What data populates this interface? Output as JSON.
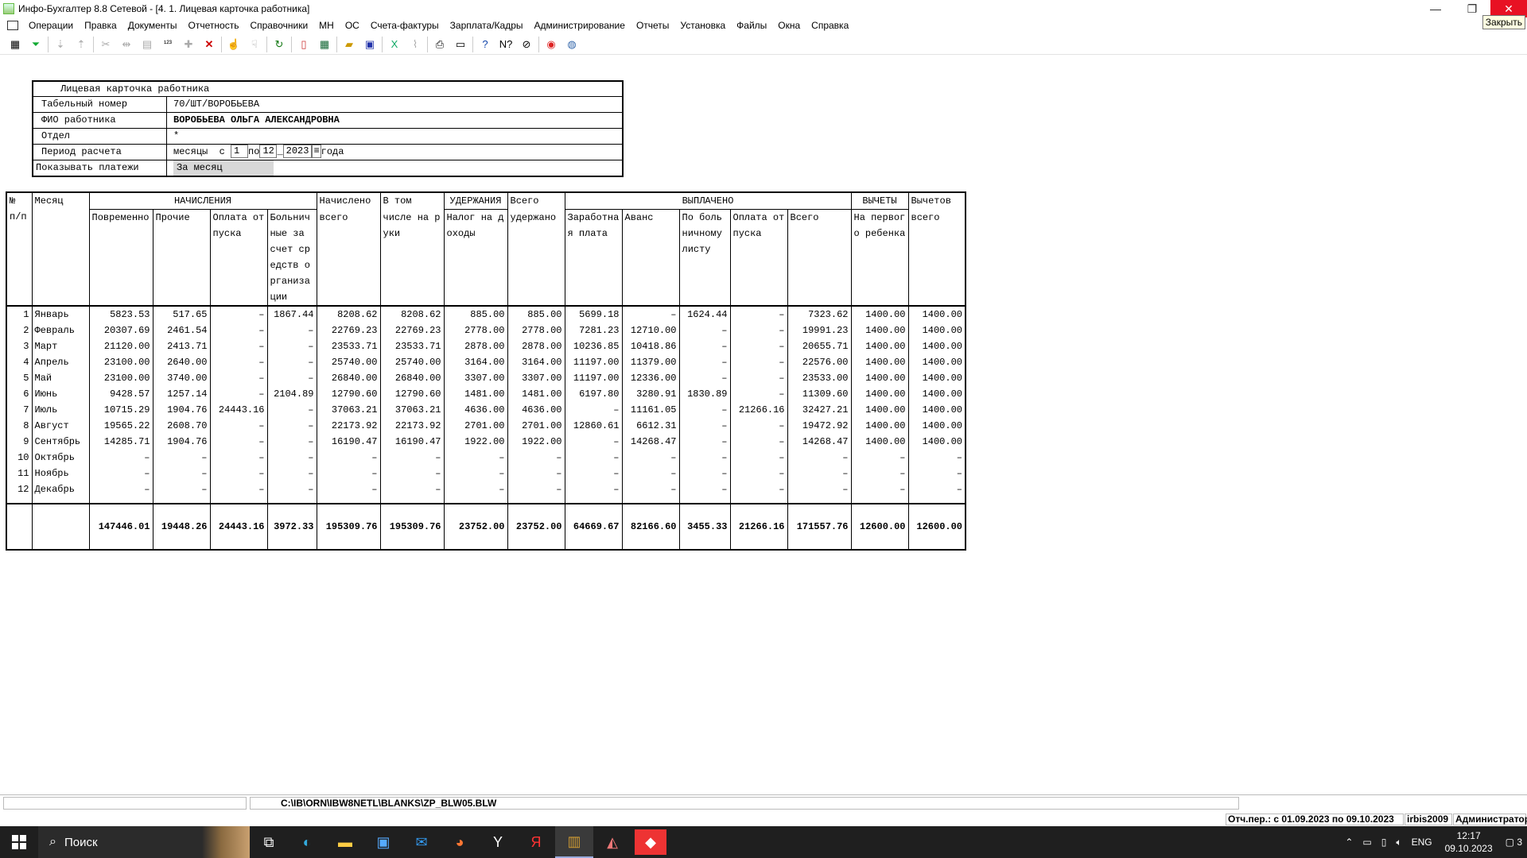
{
  "window": {
    "title": "Инфо-Бухгалтер 8.8 Сетевой - [4. 1. Лицевая карточка работника]",
    "minimize": "—",
    "restore": "❐",
    "close": "✕",
    "close_tooltip": "Закрыть"
  },
  "menu": [
    "Операции",
    "Правка",
    "Документы",
    "Отчетность",
    "Справочники",
    "МН",
    "ОС",
    "Счета-фактуры",
    "Зарплата/Кадры",
    "Администрирование",
    "Отчеты",
    "Установка",
    "Файлы",
    "Окна",
    "Справка"
  ],
  "toolbar_icons": [
    "calculator-icon",
    "filter-icon",
    "sort-asc-icon",
    "sort-desc-icon",
    "cut-icon",
    "columns-icon",
    "paste-icon",
    "numbering-icon",
    "add-icon",
    "delete-icon",
    "pointer-icon",
    "pointer-multi-icon",
    "refresh-icon",
    "pdf-icon",
    "spreadsheet-icon",
    "open-folder-icon",
    "save-icon",
    "excel-icon",
    "broom-icon",
    "print-icon",
    "preview-icon",
    "help-icon",
    "context-help-icon",
    "compass-icon",
    "lifebuoy-icon",
    "web-icon"
  ],
  "form": {
    "title": "Лицевая карточка работника",
    "rows": [
      {
        "label": "Табельный номер",
        "value": "70/ШТ/ВОРОБЬЕВА"
      },
      {
        "label": "ФИО работника",
        "value": "ВОРОБЬЕВА ОЛЬГА АЛЕКСАНДРОВНА"
      },
      {
        "label": "Отдел",
        "value": "*"
      }
    ],
    "period": {
      "label": "Период расчета",
      "unit": "месяцы",
      "from_label": "с",
      "from": "1",
      "to_label": "по",
      "to": "12",
      "year": "2023",
      "year_suffix": "года"
    },
    "show_payments": {
      "label": "Показывать платежи",
      "value": "За месяц"
    }
  },
  "table": {
    "group_headers": {
      "num": "№ п/п",
      "month": "Месяц",
      "accruals": "НАЧИСЛЕНИЯ",
      "accrued_total": "Начислено",
      "incl_hand": "В том",
      "deductions": "УДЕРЖАНИЯ",
      "withheld_total": "Всего",
      "paid": "ВЫПЛАЧЕНО",
      "tax_deductions": "ВЫЧЕТЫ",
      "deductions_total": "Вычетов"
    },
    "sub_headers": {
      "time_pay": "Повременно",
      "other": "Прочие",
      "vacation_pay": "Оплата отпуска",
      "sick_pay": "Больничные за счет средств организации",
      "accrued_all": "всего",
      "on_hand": "числе на руки",
      "income_tax": "Налог на доходы",
      "withheld_all": "удержано",
      "salary": "Заработная плата",
      "advance": "Аванс",
      "sick_list": "По больничному листу",
      "vacation_paid": "Оплата отпуска",
      "paid_total": "Всего",
      "first_child": "На первого ребенка",
      "deductions_all": "всего"
    },
    "rows": [
      [
        "1",
        "Январь",
        "5823.53",
        "517.65",
        "–",
        "1867.44",
        "8208.62",
        "8208.62",
        "885.00",
        "885.00",
        "5699.18",
        "–",
        "1624.44",
        "–",
        "7323.62",
        "1400.00",
        "1400.00"
      ],
      [
        "2",
        "Февраль",
        "20307.69",
        "2461.54",
        "–",
        "–",
        "22769.23",
        "22769.23",
        "2778.00",
        "2778.00",
        "7281.23",
        "12710.00",
        "–",
        "–",
        "19991.23",
        "1400.00",
        "1400.00"
      ],
      [
        "3",
        "Март",
        "21120.00",
        "2413.71",
        "–",
        "–",
        "23533.71",
        "23533.71",
        "2878.00",
        "2878.00",
        "10236.85",
        "10418.86",
        "–",
        "–",
        "20655.71",
        "1400.00",
        "1400.00"
      ],
      [
        "4",
        "Апрель",
        "23100.00",
        "2640.00",
        "–",
        "–",
        "25740.00",
        "25740.00",
        "3164.00",
        "3164.00",
        "11197.00",
        "11379.00",
        "–",
        "–",
        "22576.00",
        "1400.00",
        "1400.00"
      ],
      [
        "5",
        "Май",
        "23100.00",
        "3740.00",
        "–",
        "–",
        "26840.00",
        "26840.00",
        "3307.00",
        "3307.00",
        "11197.00",
        "12336.00",
        "–",
        "–",
        "23533.00",
        "1400.00",
        "1400.00"
      ],
      [
        "6",
        "Июнь",
        "9428.57",
        "1257.14",
        "–",
        "2104.89",
        "12790.60",
        "12790.60",
        "1481.00",
        "1481.00",
        "6197.80",
        "3280.91",
        "1830.89",
        "–",
        "11309.60",
        "1400.00",
        "1400.00"
      ],
      [
        "7",
        "Июль",
        "10715.29",
        "1904.76",
        "24443.16",
        "–",
        "37063.21",
        "37063.21",
        "4636.00",
        "4636.00",
        "–",
        "11161.05",
        "–",
        "21266.16",
        "32427.21",
        "1400.00",
        "1400.00"
      ],
      [
        "8",
        "Август",
        "19565.22",
        "2608.70",
        "–",
        "–",
        "22173.92",
        "22173.92",
        "2701.00",
        "2701.00",
        "12860.61",
        "6612.31",
        "–",
        "–",
        "19472.92",
        "1400.00",
        "1400.00"
      ],
      [
        "9",
        "Сентябрь",
        "14285.71",
        "1904.76",
        "–",
        "–",
        "16190.47",
        "16190.47",
        "1922.00",
        "1922.00",
        "–",
        "14268.47",
        "–",
        "–",
        "14268.47",
        "1400.00",
        "1400.00"
      ],
      [
        "10",
        "Октябрь",
        "–",
        "–",
        "–",
        "–",
        "–",
        "–",
        "–",
        "–",
        "–",
        "–",
        "–",
        "–",
        "–",
        "–",
        "–"
      ],
      [
        "11",
        "Ноябрь",
        "–",
        "–",
        "–",
        "–",
        "–",
        "–",
        "–",
        "–",
        "–",
        "–",
        "–",
        "–",
        "–",
        "–",
        "–"
      ],
      [
        "12",
        "Декабрь",
        "–",
        "–",
        "–",
        "–",
        "–",
        "–",
        "–",
        "–",
        "–",
        "–",
        "–",
        "–",
        "–",
        "–",
        "–"
      ]
    ],
    "totals": [
      "147446.01",
      "19448.26",
      "24443.16",
      "3972.33",
      "195309.76",
      "195309.76",
      "23752.00",
      "23752.00",
      "64669.67",
      "82166.60",
      "3455.33",
      "21266.16",
      "171557.76",
      "12600.00",
      "12600.00"
    ]
  },
  "status": {
    "path": "C:\\IB\\ORN\\IBW8NETL\\BLANKS\\ZP_BLW05.BLW",
    "period": "Отч.пер.: с 01.09.2023 по 09.10.2023",
    "db": "irbis2009",
    "role": "Администратор"
  },
  "taskbar": {
    "search_placeholder": "Поиск",
    "apps": [
      "task-view-icon",
      "edge-icon",
      "explorer-icon",
      "store-icon",
      "mail-icon",
      "firefox-icon",
      "yandex-browser-icon",
      "yandex-icon",
      "accounting-app-icon",
      "app-icon",
      "anydesk-icon"
    ],
    "lang": "ENG",
    "time": "12:17",
    "date": "09.10.2023",
    "notifications": "3"
  }
}
